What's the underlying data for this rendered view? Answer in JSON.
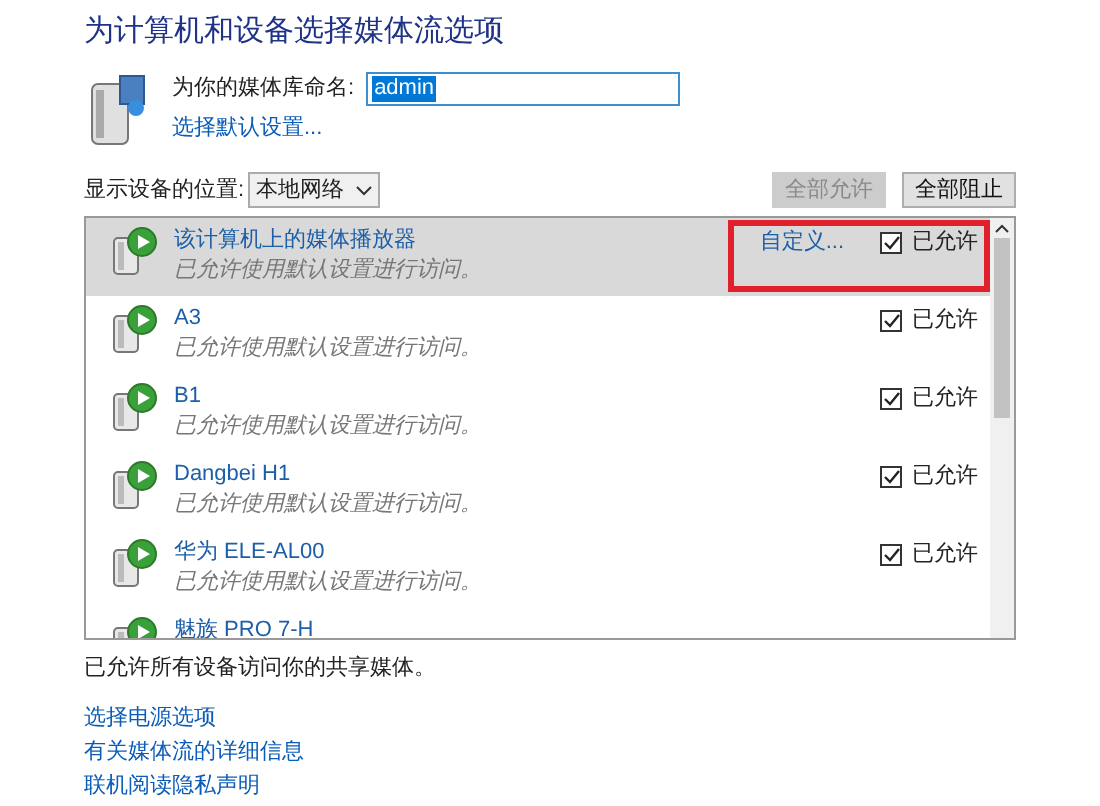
{
  "title": "为计算机和设备选择媒体流选项",
  "library_name": {
    "label": "为你的媒体库命名:",
    "value": "admin"
  },
  "default_settings_link": "选择默认设置...",
  "location": {
    "label": "显示设备的位置:",
    "value": "本地网络"
  },
  "buttons": [
    {
      "label": "全部允许",
      "disabled": true
    },
    {
      "label": "全部阻止",
      "disabled": false
    }
  ],
  "devices": [
    {
      "name": "该计算机上的媒体播放器",
      "status": "已允许使用默认设置进行访问。",
      "customize": "自定义...",
      "allowed_label": "已允许",
      "checked": true,
      "selected": true
    },
    {
      "name": "A3",
      "status": "已允许使用默认设置进行访问。",
      "allowed_label": "已允许",
      "checked": true,
      "selected": false
    },
    {
      "name": "B1",
      "status": "已允许使用默认设置进行访问。",
      "allowed_label": "已允许",
      "checked": true,
      "selected": false
    },
    {
      "name": "Dangbei H1",
      "status": "已允许使用默认设置进行访问。",
      "allowed_label": "已允许",
      "checked": true,
      "selected": false
    },
    {
      "name": "华为 ELE-AL00",
      "status": "已允许使用默认设置进行访问。",
      "allowed_label": "已允许",
      "checked": true,
      "selected": false
    },
    {
      "name": "魅族 PRO 7-H",
      "selected": false
    }
  ],
  "summary": "已允许所有设备访问你的共享媒体。",
  "links": [
    "选择电源选项",
    "有关媒体流的详细信息",
    "联机阅读隐私声明"
  ]
}
